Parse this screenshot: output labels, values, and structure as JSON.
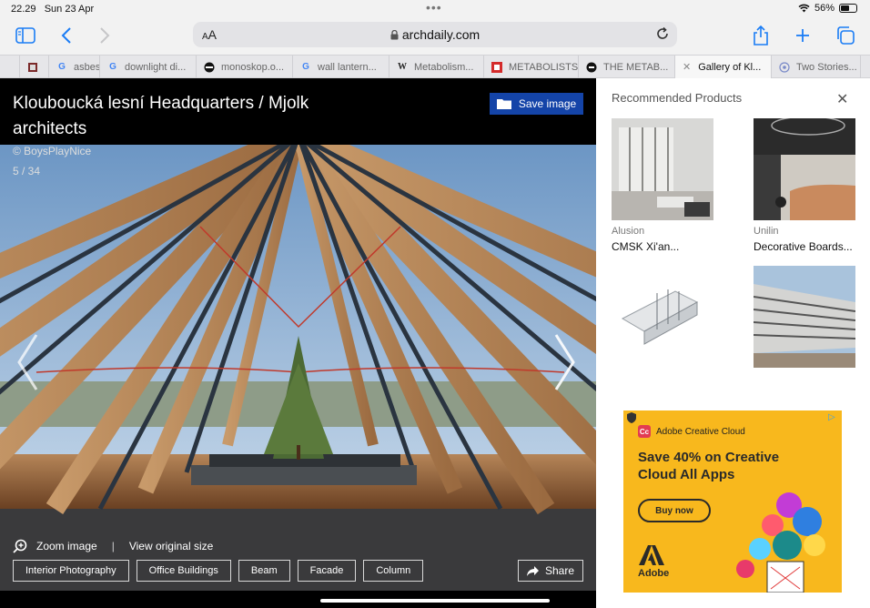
{
  "status_bar": {
    "time": "22.29",
    "date": "Sun 23 Apr",
    "battery": "56%",
    "battery_level": 0.56
  },
  "address_bar": {
    "text_size_label": "AA",
    "host": "archdaily.com"
  },
  "tabs": [
    {
      "label": "",
      "favicon": "site-favicon"
    },
    {
      "label": "asbest",
      "favicon": "google-icon"
    },
    {
      "label": "downlight di...",
      "favicon": "google-icon"
    },
    {
      "label": "monoskop.o...",
      "favicon": "monoskop-icon"
    },
    {
      "label": "wall lantern...",
      "favicon": "google-icon"
    },
    {
      "label": "Metabolism...",
      "favicon": "wikipedia-icon"
    },
    {
      "label": "METABOLISTS",
      "favicon": "red-square-icon"
    },
    {
      "label": "THE METAB...",
      "favicon": "dark-circle-icon"
    },
    {
      "label": "Gallery of Kl...",
      "favicon": "close-icon",
      "active": true
    },
    {
      "label": "Two Stories...",
      "favicon": "page-icon"
    }
  ],
  "gallery": {
    "title": "Klouboucká lesní Headquarters / Mjolk architects",
    "credit": "© BoysPlayNice",
    "counter": "5 / 34",
    "save_label": "Save image",
    "zoom_label": "Zoom image",
    "separator": "|",
    "original_label": "View original size",
    "share_label": "Share",
    "tags": [
      "Interior Photography",
      "Office Buildings",
      "Beam",
      "Facade",
      "Column"
    ]
  },
  "sidebar": {
    "heading": "Recommended Products",
    "products": [
      {
        "brand": "Alusion",
        "name": "CMSK Xi'an..."
      },
      {
        "brand": "Unilin",
        "name": "Decorative Boards..."
      },
      {
        "brand": "",
        "name": ""
      },
      {
        "brand": "",
        "name": ""
      }
    ]
  },
  "ad": {
    "brand": "Adobe Creative Cloud",
    "headline": "Save 40% on Creative Cloud All Apps",
    "cta": "Buy now",
    "logo_text": "Adobe",
    "info_icon": "ad-choices-icon",
    "colors": {
      "background": "#f8b81d"
    }
  },
  "colors": {
    "accent": "#1a7cf5",
    "save_button": "#1444a8"
  }
}
